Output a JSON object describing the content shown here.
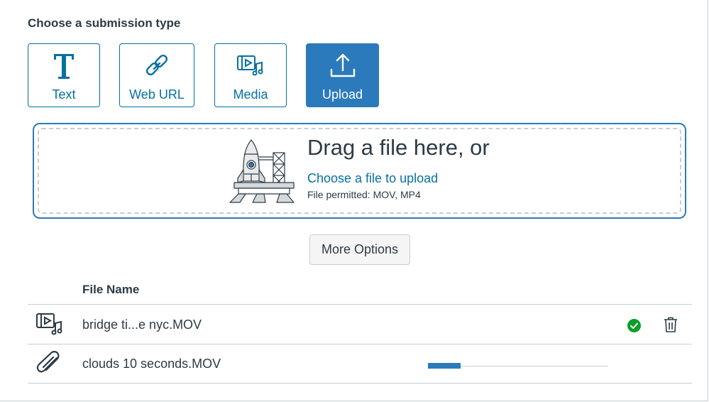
{
  "heading": "Choose a submission type",
  "submission_types": [
    {
      "label": "Text",
      "icon": "text-icon",
      "active": false
    },
    {
      "label": "Web URL",
      "icon": "link-icon",
      "active": false
    },
    {
      "label": "Media",
      "icon": "media-icon",
      "active": false
    },
    {
      "label": "Upload",
      "icon": "upload-icon",
      "active": true
    }
  ],
  "dropzone": {
    "title": "Drag a file here, or",
    "link": "Choose a file to upload",
    "permitted": "File permitted: MOV, MP4",
    "illustration": "rocket-launch-icon"
  },
  "more_options_label": "More Options",
  "files": {
    "header": "File Name",
    "rows": [
      {
        "name": "bridge ti...e nyc.MOV",
        "icon": "media-icon",
        "status": "complete",
        "status_icon": "check-circle-icon",
        "action_icon": "trash-icon"
      },
      {
        "name": "clouds 10 seconds.MOV",
        "icon": "paperclip-icon",
        "status": "uploading",
        "progress": 0.18
      }
    ]
  },
  "colors": {
    "accent": "#2b7abc",
    "link": "#0770a3",
    "success": "#0b9e28",
    "border": "#c7cdd1",
    "text": "#2d3b45"
  }
}
